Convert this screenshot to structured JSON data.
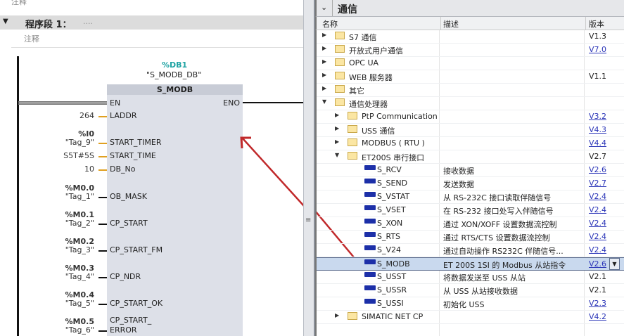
{
  "ladder": {
    "top_comment": "注释",
    "network_title": "程序段 1：",
    "network_dots": "....",
    "network_comment": "注释",
    "instance_db": "%DB1",
    "instance_db_name": "\"S_MODB_DB\"",
    "block_name": "S_MODB",
    "en": "EN",
    "eno": "ENO",
    "pins": [
      {
        "addr": "",
        "value": "264",
        "name": "LADDR",
        "color": "#e0a020"
      },
      {
        "addr": "%I0",
        "value": "\"Tag_9\"",
        "name": "START_TIMER",
        "color": "#e0a020"
      },
      {
        "addr": "",
        "value": "S5T#5S",
        "name": "START_TIME",
        "color": "#e0a020"
      },
      {
        "addr": "",
        "value": "10",
        "name": "DB_No",
        "color": "#e0a020"
      },
      {
        "addr": "%M0.0",
        "value": "\"Tag_1\"",
        "name": "OB_MASK",
        "color": "#111111"
      },
      {
        "addr": "%M0.1",
        "value": "\"Tag_2\"",
        "name": "CP_START",
        "color": "#111111"
      },
      {
        "addr": "%M0.2",
        "value": "\"Tag_3\"",
        "name": "CP_START_FM",
        "color": "#111111"
      },
      {
        "addr": "%M0.3",
        "value": "\"Tag_4\"",
        "name": "CP_NDR",
        "color": "#111111"
      },
      {
        "addr": "%M0.4",
        "value": "\"Tag_5\"",
        "name": "CP_START_OK",
        "color": "#111111"
      },
      {
        "addr": "%M0.5",
        "value": "\"Tag_6\"",
        "name": "ERROR",
        "name_line1": "CP_START_",
        "color": "#111111"
      }
    ]
  },
  "instructions": {
    "section_title": "通信",
    "columns": {
      "name": "名称",
      "desc": "描述",
      "version": "版本"
    },
    "rows": [
      {
        "level": 0,
        "type": "folder",
        "expand": "collapsed",
        "name": "S7 通信",
        "desc": "",
        "version": "V1.3",
        "link": false
      },
      {
        "level": 0,
        "type": "folder",
        "expand": "collapsed",
        "name": "开放式用户通信",
        "desc": "",
        "version": "V7.0",
        "link": true
      },
      {
        "level": 0,
        "type": "folder",
        "expand": "collapsed",
        "name": "OPC UA",
        "desc": "",
        "version": "",
        "link": false
      },
      {
        "level": 0,
        "type": "folder",
        "expand": "collapsed",
        "name": "WEB 服务器",
        "desc": "",
        "version": "V1.1",
        "link": false
      },
      {
        "level": 0,
        "type": "folder",
        "expand": "collapsed",
        "name": "其它",
        "desc": "",
        "version": "",
        "link": false
      },
      {
        "level": 0,
        "type": "folder",
        "expand": "expanded",
        "name": "通信处理器",
        "desc": "",
        "version": "",
        "link": false
      },
      {
        "level": 1,
        "type": "folder",
        "expand": "collapsed",
        "name": "PtP Communication",
        "desc": "",
        "version": "V3.2",
        "link": true
      },
      {
        "level": 1,
        "type": "folder",
        "expand": "collapsed",
        "name": "USS 通信",
        "desc": "",
        "version": "V4.3",
        "link": true
      },
      {
        "level": 1,
        "type": "folder",
        "expand": "collapsed",
        "name": "MODBUS ( RTU )",
        "desc": "",
        "version": "V4.4",
        "link": true
      },
      {
        "level": 1,
        "type": "folder",
        "expand": "expanded",
        "name": "ET200S 串行接口",
        "desc": "",
        "version": "V2.7",
        "link": false
      },
      {
        "level": 2,
        "type": "block",
        "name": "S_RCV",
        "desc": "接收数据",
        "version": "V2.6",
        "link": true
      },
      {
        "level": 2,
        "type": "block",
        "name": "S_SEND",
        "desc": "发送数据",
        "version": "V2.7",
        "link": true
      },
      {
        "level": 2,
        "type": "block",
        "name": "S_VSTAT",
        "desc": "从 RS-232C 接口读取伴随信号",
        "version": "V2.4",
        "link": true
      },
      {
        "level": 2,
        "type": "block",
        "name": "S_VSET",
        "desc": "在 RS-232 接口处写入伴随信号",
        "version": "V2.4",
        "link": true
      },
      {
        "level": 2,
        "type": "block",
        "name": "S_XON",
        "desc": "通过 XON/XOFF 设置数据流控制",
        "version": "V2.4",
        "link": true
      },
      {
        "level": 2,
        "type": "block",
        "name": "S_RTS",
        "desc": "通过 RTS/CTS 设置数据流控制",
        "version": "V2.4",
        "link": true
      },
      {
        "level": 2,
        "type": "block",
        "name": "S_V24",
        "desc": "通过自动操作 RS232C 伴随信号...",
        "version": "V2.4",
        "link": true
      },
      {
        "level": 2,
        "type": "block",
        "name": "S_MODB",
        "desc": "ET 200S 1SI 的 Modbus 从站指令",
        "version": "V2.6",
        "link": true,
        "selected": true
      },
      {
        "level": 2,
        "type": "block",
        "name": "S_USST",
        "desc": "将数据发送至 USS 从站",
        "version": "V2.1",
        "link": false
      },
      {
        "level": 2,
        "type": "block",
        "name": "S_USSR",
        "desc": "从 USS 从站接收数据",
        "version": "V2.1",
        "link": false
      },
      {
        "level": 2,
        "type": "block",
        "name": "S_USSI",
        "desc": "初始化 USS",
        "version": "V2.3",
        "link": true
      },
      {
        "level": 1,
        "type": "folder",
        "expand": "collapsed",
        "name": "SIMATIC NET CP",
        "desc": "",
        "version": "V4.2",
        "link": true
      }
    ]
  },
  "colors": {
    "selected_row": "#c9d9ee",
    "accent_teal": "#1fa3a3",
    "arrow": "#c0282a",
    "link": "#2b35b8"
  }
}
